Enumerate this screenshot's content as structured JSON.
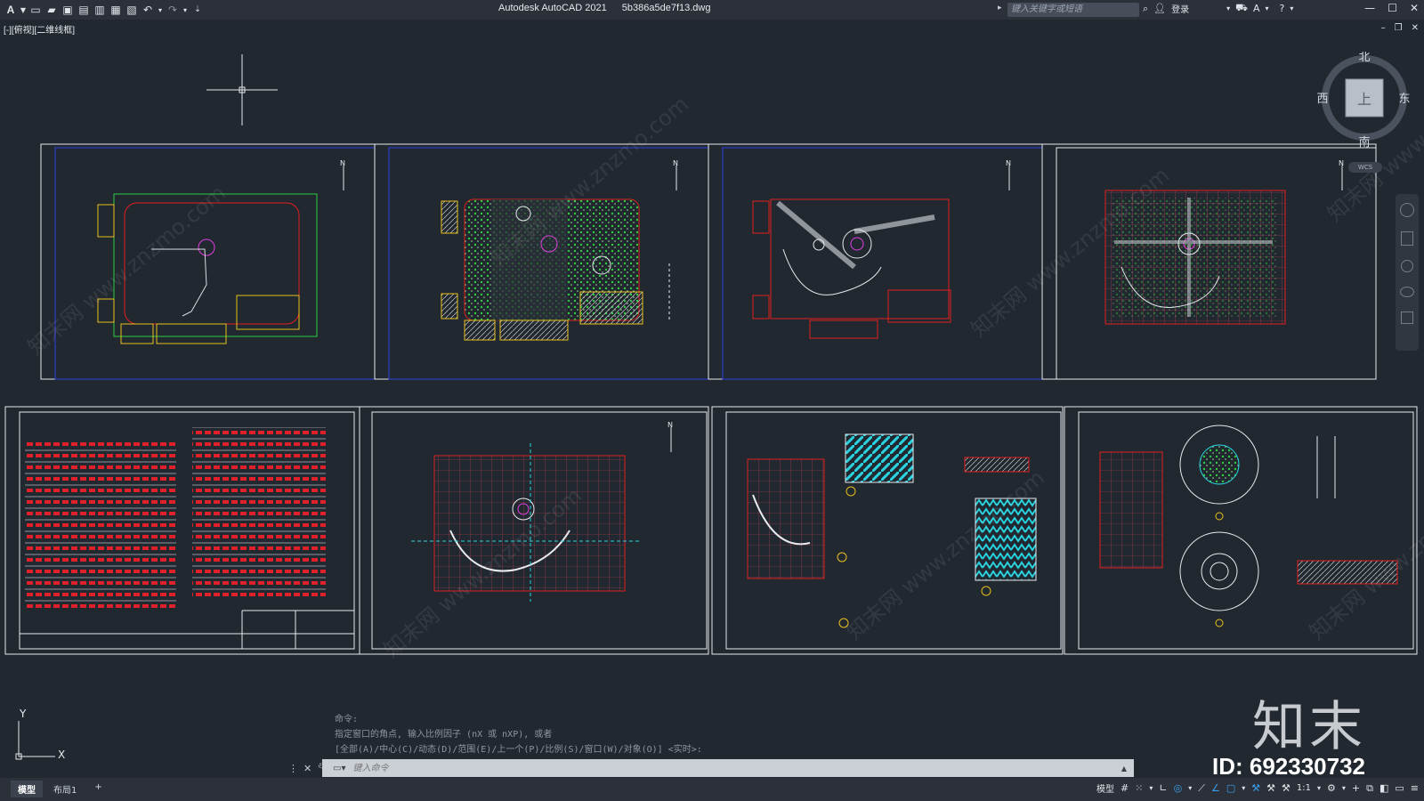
{
  "app": {
    "logo": "A",
    "title": "Autodesk AutoCAD 2021",
    "filename": "5b386a5de7f13.dwg"
  },
  "quick_access": [
    "new-icon",
    "open-icon",
    "save-icon",
    "save-as-icon",
    "plot-preview-icon",
    "publish-icon",
    "plot-icon",
    "undo-icon",
    "redo-icon",
    "workspace-icon"
  ],
  "search": {
    "placeholder": "键入关键字或短语"
  },
  "user": {
    "signin": "登录"
  },
  "viewport": {
    "label": "[-][俯视][二维线框]"
  },
  "viewcube": {
    "north": "北",
    "south": "南",
    "east": "东",
    "west": "西",
    "face": "上",
    "wcs": "WCS"
  },
  "ucs": {
    "x": "X",
    "y": "Y"
  },
  "command": {
    "history": [
      "命令:",
      "指定窗口的角点, 输入比例因子 (nX 或 nXP), 或者",
      "[全部(A)/中心(C)/动态(D)/范围(E)/上一个(P)/比例(S)/窗口(W)/对象(O)] <实时>:"
    ],
    "placeholder": "键入命令"
  },
  "layout_tabs": [
    "模型",
    "布局1",
    "+"
  ],
  "status": {
    "model": "模型",
    "scale": "1:1"
  },
  "watermark": {
    "logo": "知末",
    "id": "ID: 692330732",
    "diag": "知末网 www.znzmo.com"
  },
  "colors": {
    "bg": "#212830",
    "bar": "#2b3039",
    "accent": "#e2262a"
  }
}
